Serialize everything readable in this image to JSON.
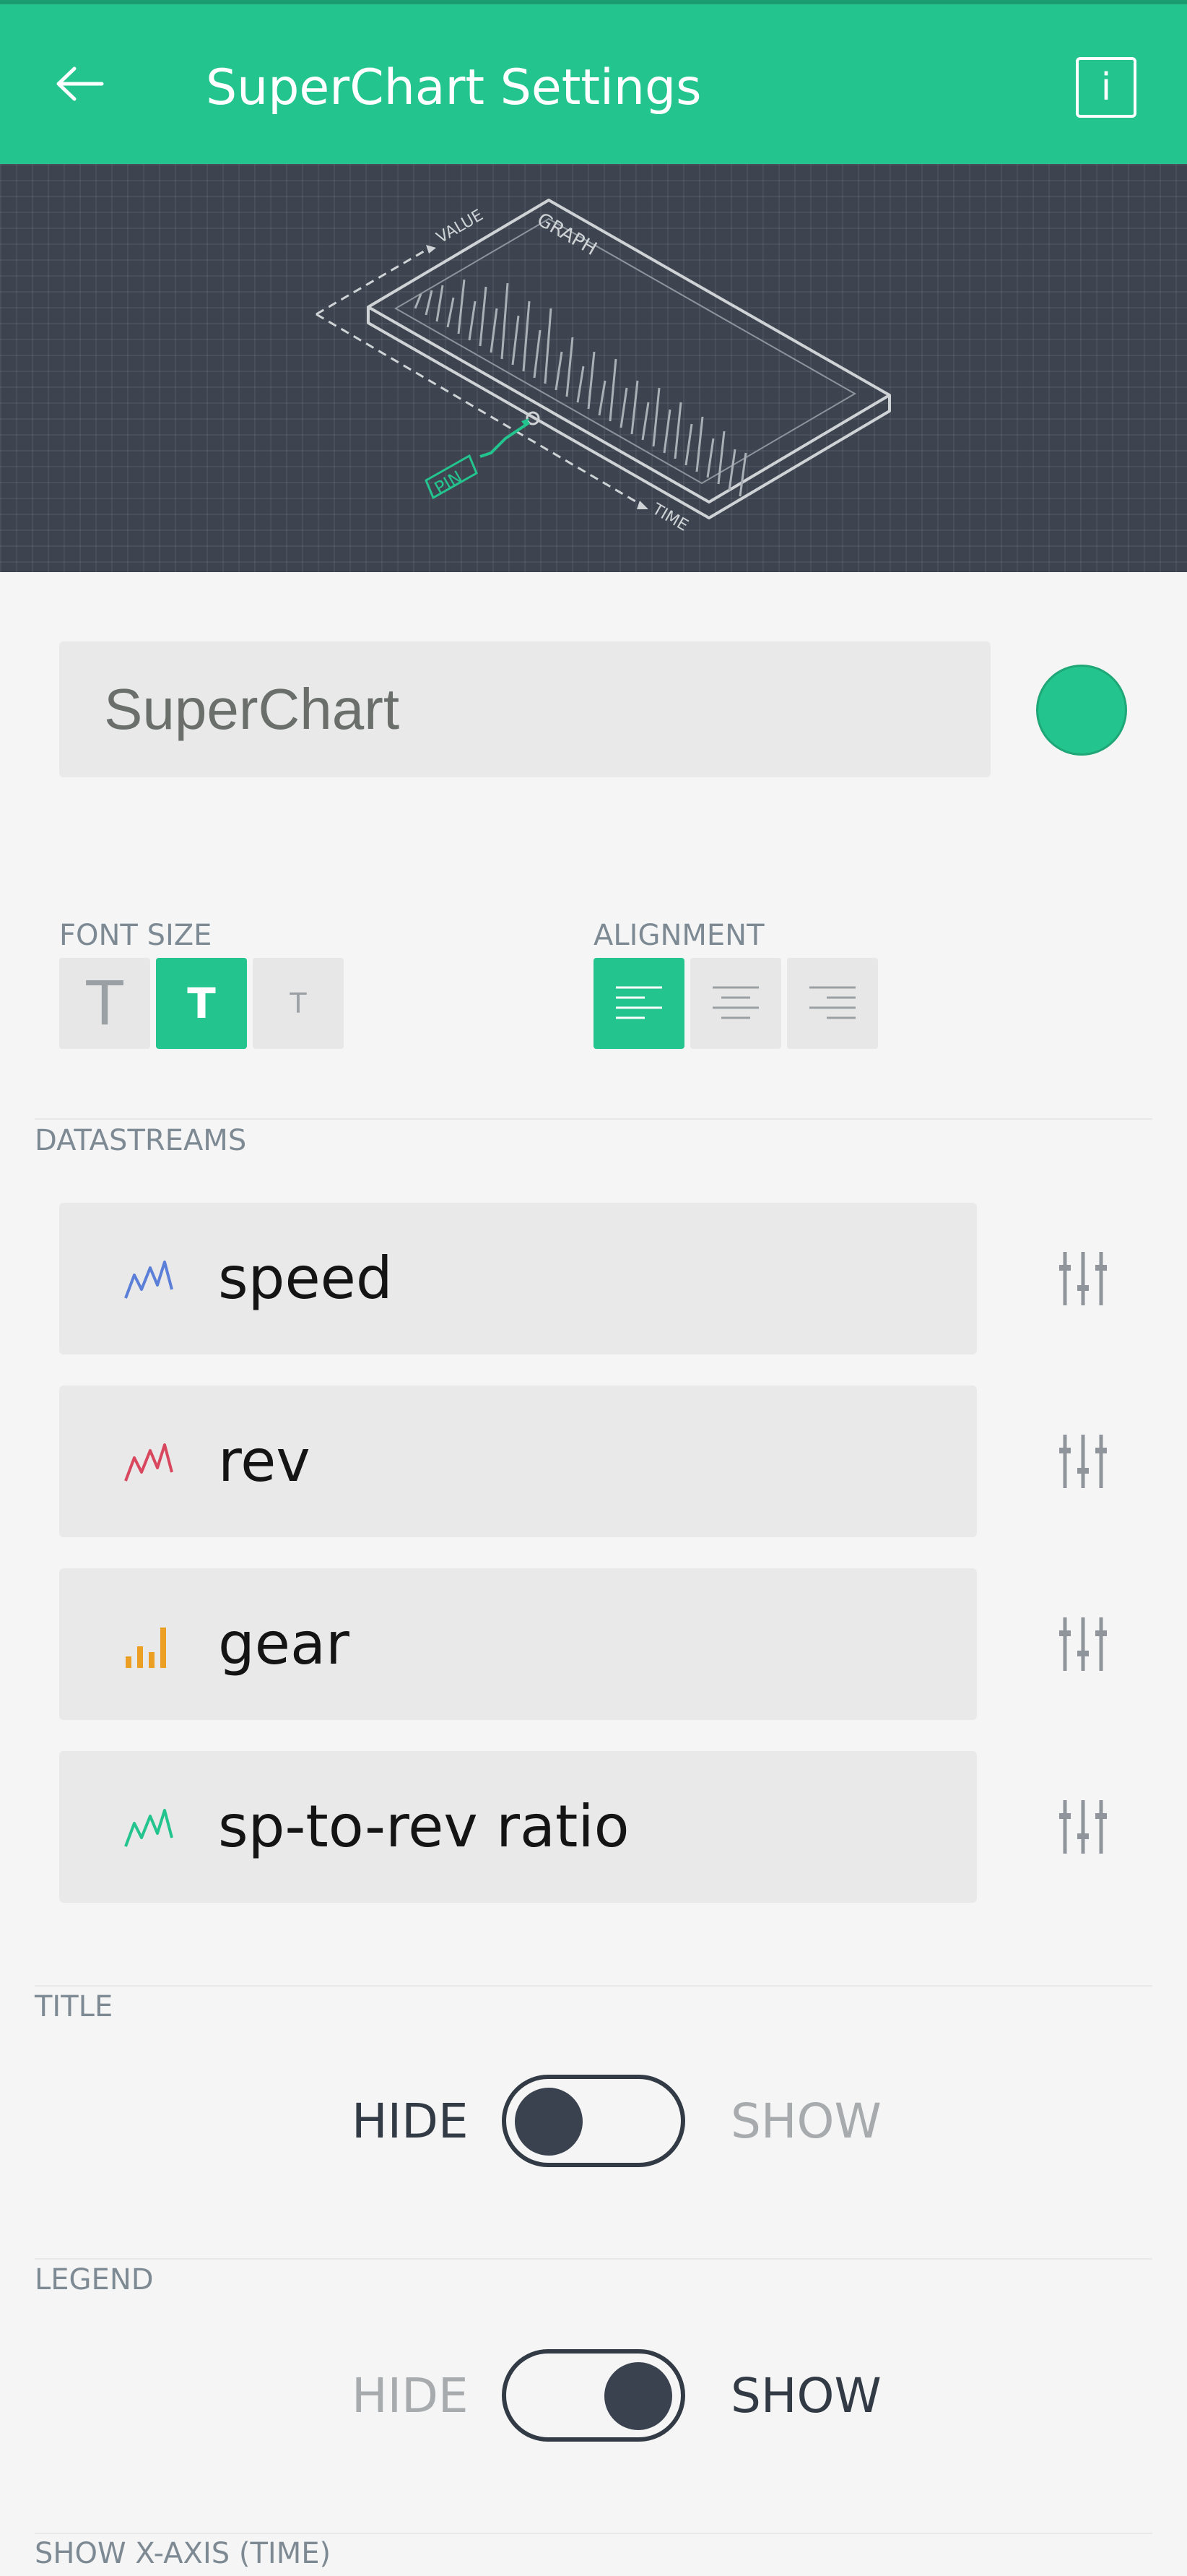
{
  "header": {
    "title": "SuperChart Settings",
    "info_label": "i"
  },
  "hero": {
    "value_label": "VALUE",
    "graph_label": "GRAPH",
    "pin_label": "PIN",
    "time_label": "TIME"
  },
  "widget": {
    "name_value": "SuperChart",
    "name_placeholder": "SuperChart",
    "color": "#23c48e"
  },
  "font_size": {
    "label": "FONT SIZE",
    "options": [
      "T",
      "T",
      "T"
    ],
    "selected_index": 1
  },
  "alignment": {
    "label": "ALIGNMENT",
    "options": [
      "left",
      "center",
      "right"
    ],
    "selected_index": 0
  },
  "datastreams": {
    "label": "DATASTREAMS",
    "items": [
      {
        "name": "speed",
        "icon": "line-chart-icon",
        "color": "#5b7fd8"
      },
      {
        "name": "rev",
        "icon": "line-chart-icon",
        "color": "#d9475e"
      },
      {
        "name": "gear",
        "icon": "bar-chart-icon",
        "color": "#eba023"
      },
      {
        "name": "sp-to-rev ratio",
        "icon": "line-chart-icon",
        "color": "#23c48e"
      }
    ]
  },
  "title_section": {
    "label": "TITLE",
    "hide": "HIDE",
    "show": "SHOW",
    "state": "hide"
  },
  "legend_section": {
    "label": "LEGEND",
    "hide": "HIDE",
    "show": "SHOW",
    "state": "show"
  },
  "xaxis_section": {
    "label": "SHOW X-AXIS (TIME)"
  },
  "colors": {
    "accent": "#23c48e",
    "dark": "#323b45"
  }
}
